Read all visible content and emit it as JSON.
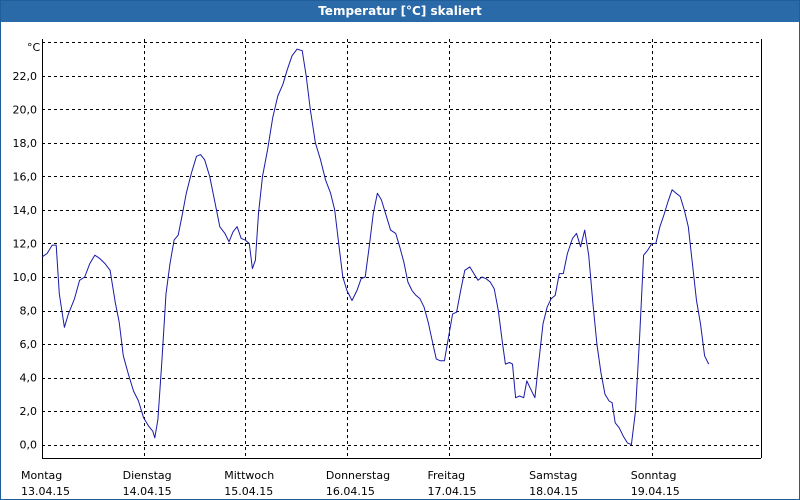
{
  "window": {
    "title": "Temperatur [°C] skaliert"
  },
  "chart_data": {
    "type": "line",
    "title": "Temperatur [°C] skaliert",
    "ylabel": "°C",
    "xlabel": "",
    "ylim": [
      -0.8,
      24.2
    ],
    "xlim": [
      0,
      7.075
    ],
    "grid": true,
    "yticks": [
      {
        "v": 0,
        "label": "0,0"
      },
      {
        "v": 2,
        "label": "2,0"
      },
      {
        "v": 4,
        "label": "4,0"
      },
      {
        "v": 6,
        "label": "6,0"
      },
      {
        "v": 8,
        "label": "8,0"
      },
      {
        "v": 10,
        "label": "10,0"
      },
      {
        "v": 12,
        "label": "12,0"
      },
      {
        "v": 14,
        "label": "14,0"
      },
      {
        "v": 16,
        "label": "16,0"
      },
      {
        "v": 18,
        "label": "18,0"
      },
      {
        "v": 20,
        "label": "20,0"
      },
      {
        "v": 22,
        "label": "22,0"
      }
    ],
    "xticks": [
      {
        "v": 0,
        "day": "Montag",
        "date": "13.04.15"
      },
      {
        "v": 1,
        "day": "Dienstag",
        "date": "14.04.15"
      },
      {
        "v": 2,
        "day": "Mittwoch",
        "date": "15.04.15"
      },
      {
        "v": 3,
        "day": "Donnerstag",
        "date": "16.04.15"
      },
      {
        "v": 4,
        "day": "Freitag",
        "date": "17.04.15"
      },
      {
        "v": 5,
        "day": "Samstag",
        "date": "18.04.15"
      },
      {
        "v": 6,
        "day": "Sonntag",
        "date": "19.04.15"
      }
    ],
    "series": [
      {
        "color": "#1a1aa8",
        "points": [
          [
            0.0,
            11.2
          ],
          [
            0.05,
            11.4
          ],
          [
            0.1,
            11.9
          ],
          [
            0.14,
            11.9
          ],
          [
            0.17,
            9.0
          ],
          [
            0.22,
            7.0
          ],
          [
            0.26,
            7.8
          ],
          [
            0.32,
            8.7
          ],
          [
            0.37,
            9.8
          ],
          [
            0.42,
            10.0
          ],
          [
            0.47,
            10.8
          ],
          [
            0.52,
            11.3
          ],
          [
            0.57,
            11.1
          ],
          [
            0.62,
            10.8
          ],
          [
            0.67,
            10.4
          ],
          [
            0.72,
            8.5
          ],
          [
            0.76,
            7.3
          ],
          [
            0.8,
            5.3
          ],
          [
            0.85,
            4.2
          ],
          [
            0.9,
            3.2
          ],
          [
            0.95,
            2.6
          ],
          [
            1.0,
            1.6
          ],
          [
            1.05,
            1.1
          ],
          [
            1.09,
            0.8
          ],
          [
            1.11,
            0.4
          ],
          [
            1.14,
            1.5
          ],
          [
            1.18,
            5.0
          ],
          [
            1.22,
            9.0
          ],
          [
            1.26,
            10.8
          ],
          [
            1.3,
            12.2
          ],
          [
            1.34,
            12.5
          ],
          [
            1.38,
            13.7
          ],
          [
            1.42,
            15.0
          ],
          [
            1.47,
            16.2
          ],
          [
            1.52,
            17.2
          ],
          [
            1.56,
            17.3
          ],
          [
            1.6,
            17.0
          ],
          [
            1.65,
            16.0
          ],
          [
            1.7,
            14.5
          ],
          [
            1.75,
            13.0
          ],
          [
            1.8,
            12.6
          ],
          [
            1.84,
            12.1
          ],
          [
            1.88,
            12.7
          ],
          [
            1.92,
            13.0
          ],
          [
            1.96,
            12.3
          ],
          [
            2.0,
            12.2
          ],
          [
            2.04,
            12.0
          ],
          [
            2.07,
            10.5
          ],
          [
            2.1,
            11.0
          ],
          [
            2.13,
            13.8
          ],
          [
            2.17,
            16.0
          ],
          [
            2.22,
            17.6
          ],
          [
            2.27,
            19.5
          ],
          [
            2.32,
            20.8
          ],
          [
            2.37,
            21.5
          ],
          [
            2.41,
            22.3
          ],
          [
            2.46,
            23.2
          ],
          [
            2.51,
            23.6
          ],
          [
            2.56,
            23.5
          ],
          [
            2.6,
            22.0
          ],
          [
            2.64,
            20.0
          ],
          [
            2.69,
            18.0
          ],
          [
            2.74,
            17.0
          ],
          [
            2.79,
            15.8
          ],
          [
            2.84,
            15.0
          ],
          [
            2.88,
            14.0
          ],
          [
            2.92,
            12.0
          ],
          [
            2.96,
            10.0
          ],
          [
            3.0,
            9.2
          ],
          [
            3.05,
            8.6
          ],
          [
            3.1,
            9.2
          ],
          [
            3.14,
            9.9
          ],
          [
            3.18,
            10.0
          ],
          [
            3.22,
            11.8
          ],
          [
            3.26,
            13.8
          ],
          [
            3.3,
            15.0
          ],
          [
            3.34,
            14.6
          ],
          [
            3.38,
            13.8
          ],
          [
            3.43,
            12.8
          ],
          [
            3.48,
            12.6
          ],
          [
            3.52,
            11.8
          ],
          [
            3.56,
            10.9
          ],
          [
            3.6,
            9.7
          ],
          [
            3.64,
            9.2
          ],
          [
            3.68,
            8.9
          ],
          [
            3.72,
            8.7
          ],
          [
            3.76,
            8.2
          ],
          [
            3.8,
            7.3
          ],
          [
            3.84,
            6.2
          ],
          [
            3.88,
            5.1
          ],
          [
            3.92,
            5.0
          ],
          [
            3.96,
            5.0
          ],
          [
            4.0,
            6.4
          ],
          [
            4.04,
            7.8
          ],
          [
            4.08,
            7.9
          ],
          [
            4.12,
            9.2
          ],
          [
            4.16,
            10.4
          ],
          [
            4.21,
            10.6
          ],
          [
            4.25,
            10.2
          ],
          [
            4.29,
            9.8
          ],
          [
            4.33,
            10.0
          ],
          [
            4.37,
            9.9
          ],
          [
            4.41,
            9.7
          ],
          [
            4.45,
            9.3
          ],
          [
            4.49,
            8.0
          ],
          [
            4.53,
            6.1
          ],
          [
            4.56,
            4.8
          ],
          [
            4.6,
            4.9
          ],
          [
            4.63,
            4.8
          ],
          [
            4.66,
            2.8
          ],
          [
            4.7,
            2.9
          ],
          [
            4.74,
            2.8
          ],
          [
            4.77,
            3.8
          ],
          [
            4.81,
            3.3
          ],
          [
            4.85,
            2.8
          ],
          [
            4.89,
            5.0
          ],
          [
            4.93,
            7.2
          ],
          [
            4.97,
            8.2
          ],
          [
            5.01,
            8.7
          ],
          [
            5.05,
            8.9
          ],
          [
            5.09,
            10.2
          ],
          [
            5.13,
            10.2
          ],
          [
            5.17,
            11.4
          ],
          [
            5.22,
            12.3
          ],
          [
            5.26,
            12.6
          ],
          [
            5.3,
            11.8
          ],
          [
            5.34,
            12.8
          ],
          [
            5.38,
            11.3
          ],
          [
            5.42,
            8.5
          ],
          [
            5.46,
            6.0
          ],
          [
            5.5,
            4.3
          ],
          [
            5.54,
            3.0
          ],
          [
            5.58,
            2.6
          ],
          [
            5.61,
            2.5
          ],
          [
            5.64,
            1.3
          ],
          [
            5.68,
            1.0
          ],
          [
            5.72,
            0.5
          ],
          [
            5.76,
            0.1
          ],
          [
            5.8,
            0.0
          ],
          [
            5.84,
            2.0
          ],
          [
            5.88,
            6.4
          ],
          [
            5.92,
            11.3
          ],
          [
            5.96,
            11.6
          ],
          [
            6.0,
            12.0
          ],
          [
            6.04,
            12.0
          ],
          [
            6.08,
            13.0
          ],
          [
            6.12,
            13.7
          ],
          [
            6.16,
            14.5
          ],
          [
            6.2,
            15.2
          ],
          [
            6.24,
            15.0
          ],
          [
            6.28,
            14.8
          ],
          [
            6.32,
            14.0
          ],
          [
            6.36,
            13.0
          ],
          [
            6.4,
            10.8
          ],
          [
            6.44,
            8.6
          ],
          [
            6.48,
            7.2
          ],
          [
            6.52,
            5.3
          ],
          [
            6.56,
            4.8
          ]
        ]
      }
    ]
  }
}
